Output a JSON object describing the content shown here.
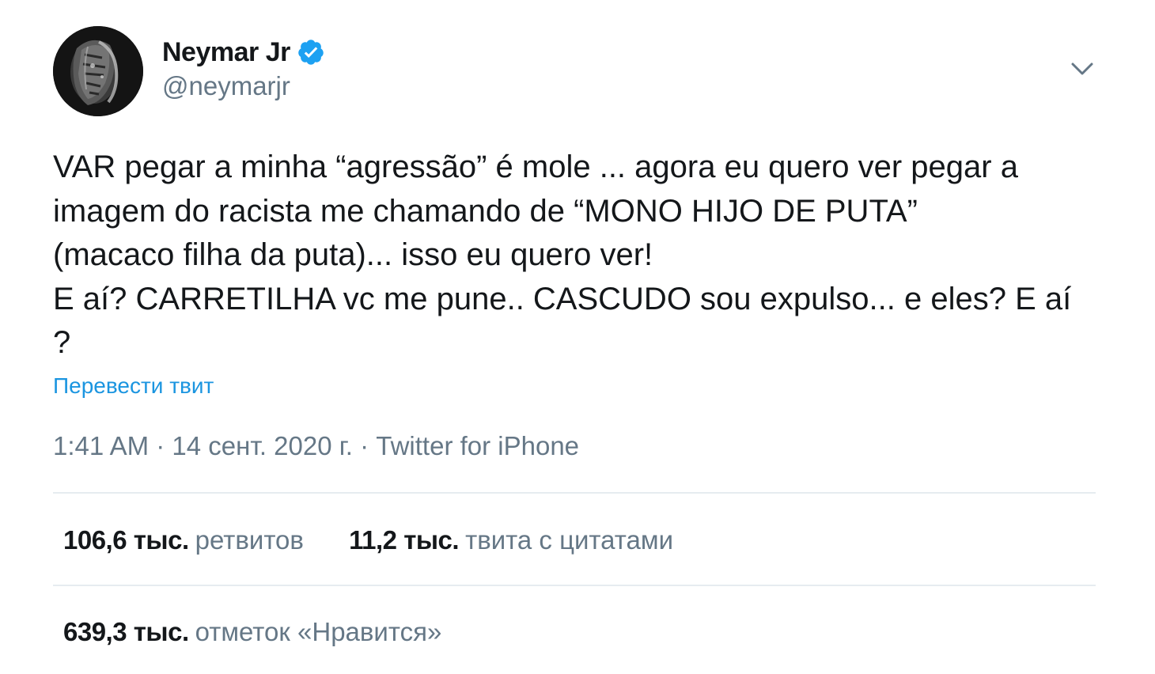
{
  "author": {
    "display_name": "Neymar Jr",
    "handle": "@neymarjr",
    "verified": true,
    "verified_color": "#1da1f2"
  },
  "tweet": {
    "text_lines": [
      "VAR pegar a minha “agressão” é mole ... agora eu quero ver pegar a",
      "imagem do racista me chamando de “MONO HIJO DE PUTA”",
      "(macaco filha da puta)... isso eu quero ver!",
      "E aí? CARRETILHA vc me pune.. CASCUDO sou expulso... e eles? E aí",
      "?"
    ],
    "translate_label": "Перевести твит",
    "time": "1:41 AM",
    "date": "14 сент. 2020 г.",
    "separator": " · ",
    "source": "Twitter for iPhone"
  },
  "stats": {
    "retweets": {
      "value": "106,6 тыс.",
      "label": "ретвитов"
    },
    "quotes": {
      "value": "11,2 тыс.",
      "label": "твита с цитатами"
    },
    "likes": {
      "value": "639,3 тыс.",
      "label": "отметок «Нравится»"
    }
  },
  "icons": {
    "menu": "chevron-down-icon",
    "verified": "verified-badge-icon",
    "avatar": "avatar"
  },
  "colors": {
    "text": "#14171a",
    "secondary": "#657786",
    "link": "#1b95e0",
    "divider": "#e6ecf0"
  }
}
